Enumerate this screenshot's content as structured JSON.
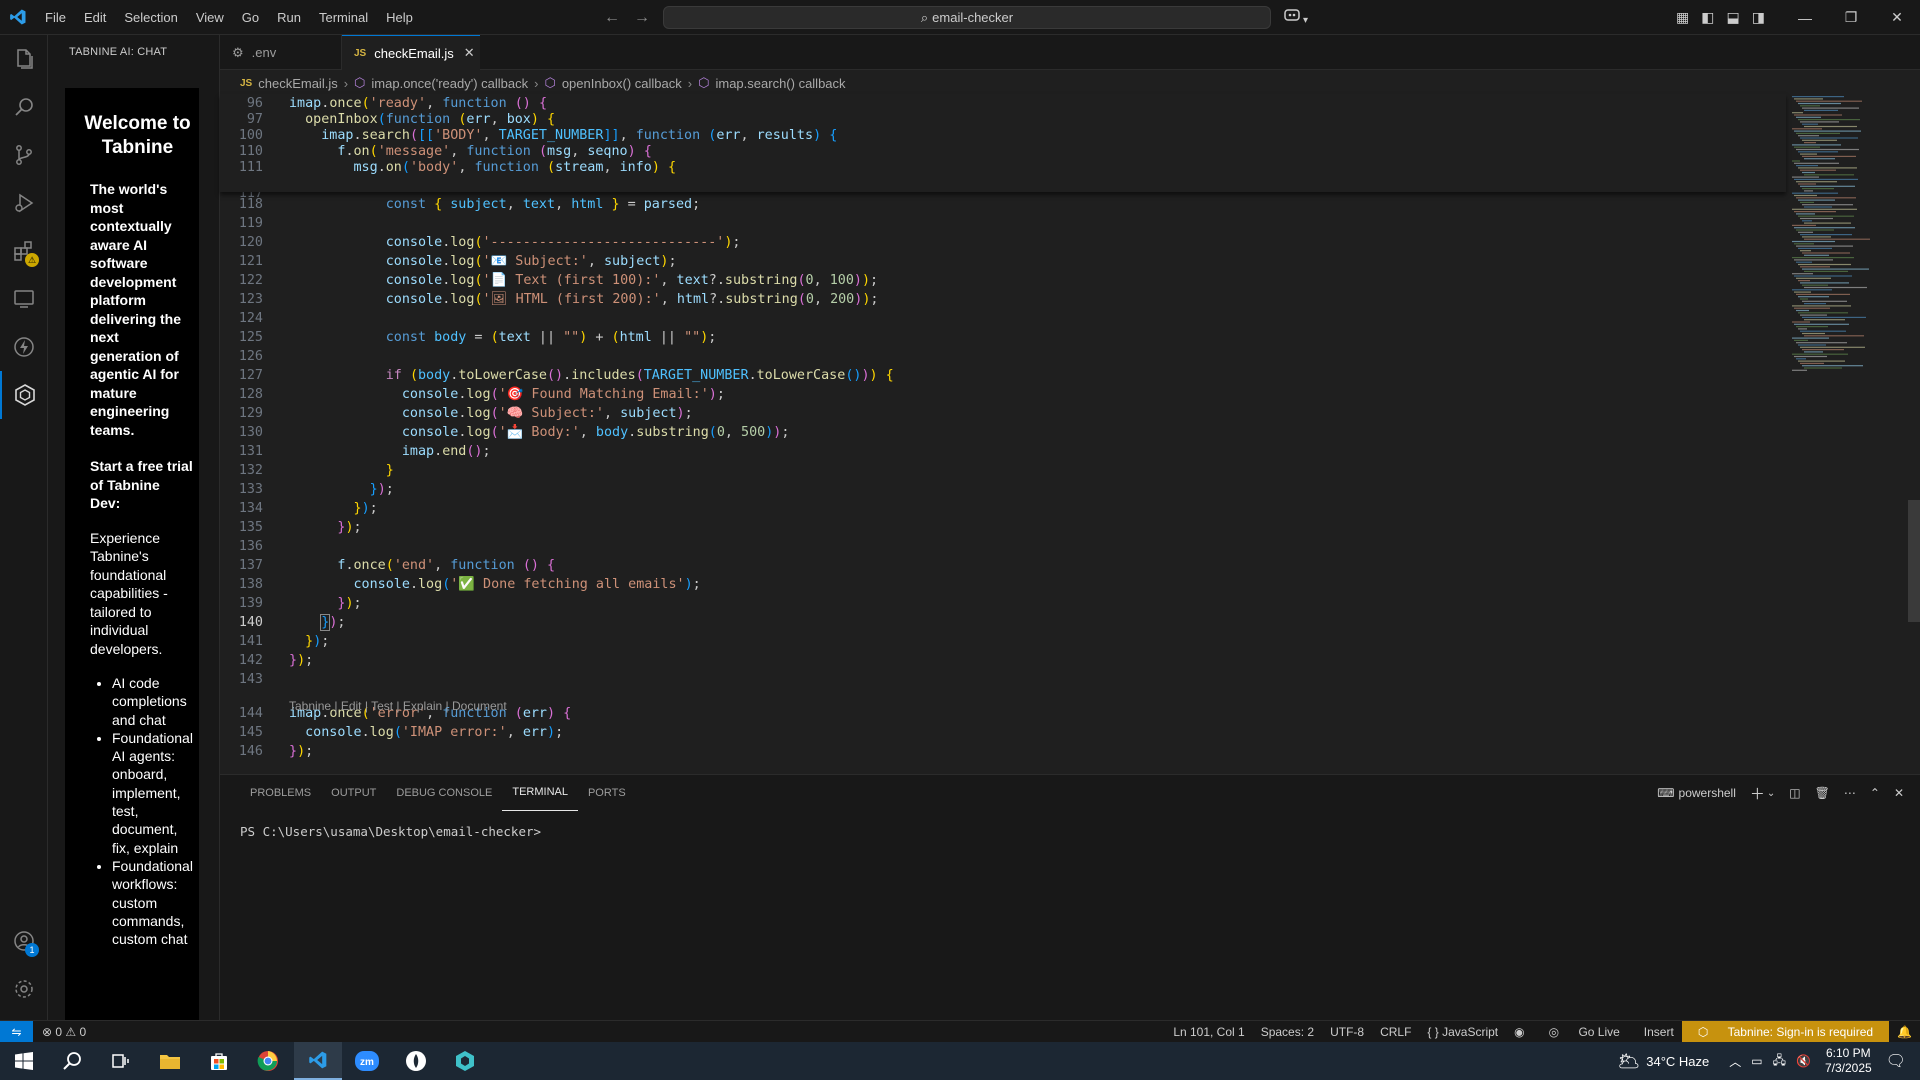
{
  "titlebar": {
    "menu": [
      "File",
      "Edit",
      "Selection",
      "View",
      "Go",
      "Run",
      "Terminal",
      "Help"
    ],
    "search": "email-checker"
  },
  "sidebar": {
    "title": "TABNINE AI: CHAT",
    "welcome": "Welcome to Tabnine",
    "intro": "The world's most contextually aware AI software development platform delivering the next generation of agentic AI for mature engineering teams.",
    "trial": "Start a free trial of Tabnine Dev:",
    "experience": "Experience Tabnine's foundational capabilities - tailored to individual developers.",
    "features": [
      "AI code completions and chat",
      "Foundational AI agents: onboard, implement, test, document, fix, explain",
      "Foundational workflows: custom commands, custom chat"
    ]
  },
  "activity_badges": {
    "extensions": "⚠",
    "accounts": "1"
  },
  "tabs": [
    {
      "label": ".env",
      "active": false
    },
    {
      "label": "checkEmail.js",
      "active": true
    }
  ],
  "breadcrumbs": [
    "checkEmail.js",
    "imap.once('ready') callback",
    "openInbox() callback",
    "imap.search() callback"
  ],
  "codelens": "Tabnine | Edit | Test | Explain | Document",
  "code": {
    "sticky": [
      {
        "n": "96",
        "html": "<span class='var'>imap</span>.<span class='fn'>once</span><span class='br1'>(</span><span class='str'>'ready'</span>, <span class='kw'>function</span> <span class='br2'>()</span> <span class='br2'>{</span>"
      },
      {
        "n": "97",
        "html": "  <span class='fn'>openInbox</span><span class='br3'>(</span><span class='kw'>function</span> <span class='br1'>(</span><span class='var'>err</span>, <span class='var'>box</span><span class='br1'>)</span> <span class='br1'>{</span>"
      },
      {
        "n": "100",
        "html": "    <span class='var'>imap</span>.<span class='fn'>search</span><span class='br2'>(</span><span class='br3'>[[</span><span class='str'>'BODY'</span>, <span class='ct'>TARGET_NUMBER</span><span class='br3'>]]</span>, <span class='kw'>function</span> <span class='br3'>(</span><span class='var'>err</span>, <span class='var'>results</span><span class='br3'>)</span> <span class='br3'>{</span>"
      },
      {
        "n": "110",
        "html": "      <span class='var'>f</span>.<span class='fn'>on</span><span class='br1'>(</span><span class='str'>'message'</span>, <span class='kw'>function</span> <span class='br2'>(</span><span class='var'>msg</span>, <span class='var'>seqno</span><span class='br2'>)</span> <span class='br2'>{</span>"
      },
      {
        "n": "111",
        "html": "        <span class='var'>msg</span>.<span class='fn'>on</span><span class='br3'>(</span><span class='str'>'body'</span>, <span class='kw'>function</span> <span class='br1'>(</span><span class='var'>stream</span>, <span class='var'>info</span><span class='br1'>)</span> <span class='br1'>{</span>"
      }
    ],
    "lines": [
      {
        "n": "117",
        "html": ""
      },
      {
        "n": "118",
        "html": "            <span class='kw'>const</span> <span class='br1'>{</span> <span class='ct'>subject</span>, <span class='ct'>text</span>, <span class='ct'>html</span> <span class='br1'>}</span> = <span class='var'>parsed</span>;"
      },
      {
        "n": "119",
        "html": ""
      },
      {
        "n": "120",
        "html": "            <span class='var'>console</span>.<span class='fn'>log</span><span class='br1'>(</span><span class='str'>'----------------------------'</span><span class='br1'>)</span>;"
      },
      {
        "n": "121",
        "html": "            <span class='var'>console</span>.<span class='fn'>log</span><span class='br1'>(</span><span class='str'>'📧 Subject:'</span>, <span class='var'>subject</span><span class='br1'>)</span>;"
      },
      {
        "n": "122",
        "html": "            <span class='var'>console</span>.<span class='fn'>log</span><span class='br1'>(</span><span class='str'>'📄 Text (first 100):'</span>, <span class='var'>text</span>?.<span class='fn'>substring</span><span class='br2'>(</span><span class='num'>0</span>, <span class='num'>100</span><span class='br2'>)</span><span class='br1'>)</span>;"
      },
      {
        "n": "123",
        "html": "            <span class='var'>console</span>.<span class='fn'>log</span><span class='br1'>(</span><span class='str'>'🖼 HTML (first 200):'</span>, <span class='var'>html</span>?.<span class='fn'>substring</span><span class='br2'>(</span><span class='num'>0</span>, <span class='num'>200</span><span class='br2'>)</span><span class='br1'>)</span>;"
      },
      {
        "n": "124",
        "html": ""
      },
      {
        "n": "125",
        "html": "            <span class='kw'>const</span> <span class='ct'>body</span> = <span class='br1'>(</span><span class='var'>text</span> || <span class='str'>\"\"</span><span class='br1'>)</span> + <span class='br1'>(</span><span class='var'>html</span> || <span class='str'>\"\"</span><span class='br1'>)</span>;"
      },
      {
        "n": "126",
        "html": ""
      },
      {
        "n": "127",
        "html": "            <span class='ctl'>if</span> <span class='br1'>(</span><span class='ct'>body</span>.<span class='fn'>toLowerCase</span><span class='br2'>()</span>.<span class='fn'>includes</span><span class='br2'>(</span><span class='ct'>TARGET_NUMBER</span>.<span class='fn'>toLowerCase</span><span class='br3'>()</span><span class='br2'>)</span><span class='br1'>)</span> <span class='br1'>{</span>"
      },
      {
        "n": "128",
        "html": "              <span class='var'>console</span>.<span class='fn'>log</span><span class='br2'>(</span><span class='str'>'🎯 Found Matching Email:'</span><span class='br2'>)</span>;"
      },
      {
        "n": "129",
        "html": "              <span class='var'>console</span>.<span class='fn'>log</span><span class='br2'>(</span><span class='str'>'🧠 Subject:'</span>, <span class='var'>subject</span><span class='br2'>)</span>;"
      },
      {
        "n": "130",
        "html": "              <span class='var'>console</span>.<span class='fn'>log</span><span class='br2'>(</span><span class='str'>'📩 Body:'</span>, <span class='ct'>body</span>.<span class='fn'>substring</span><span class='br3'>(</span><span class='num'>0</span>, <span class='num'>500</span><span class='br3'>)</span><span class='br2'>)</span>;"
      },
      {
        "n": "131",
        "html": "              <span class='var'>imap</span>.<span class='fn'>end</span><span class='br2'>()</span>;"
      },
      {
        "n": "132",
        "html": "            <span class='br1'>}</span>"
      },
      {
        "n": "133",
        "html": "          <span class='br3'>}</span><span class='br2'>)</span>;"
      },
      {
        "n": "134",
        "html": "        <span class='br1'>}</span><span class='br3'>)</span>;"
      },
      {
        "n": "135",
        "html": "      <span class='br2'>}</span><span class='br1'>)</span>;"
      },
      {
        "n": "136",
        "html": ""
      },
      {
        "n": "137",
        "html": "      <span class='var'>f</span>.<span class='fn'>once</span><span class='br1'>(</span><span class='str'>'end'</span>, <span class='kw'>function</span> <span class='br2'>()</span> <span class='br2'>{</span>"
      },
      {
        "n": "138",
        "html": "        <span class='var'>console</span>.<span class='fn'>log</span><span class='br3'>(</span><span class='str'>'✅ Done fetching all emails'</span><span class='br3'>)</span>;"
      },
      {
        "n": "139",
        "html": "      <span class='br2'>}</span><span class='br1'>)</span>;"
      },
      {
        "n": "140",
        "html": "    <span class='br3' style='outline:1px solid #888'>}</span><span class='br2'>)</span>;"
      },
      {
        "n": "141",
        "html": "  <span class='br1'>}</span><span class='br3'>)</span>;"
      },
      {
        "n": "142",
        "html": "<span class='br2'>}</span><span class='br1'>)</span>;"
      },
      {
        "n": "143",
        "html": ""
      },
      {
        "n": "144",
        "html": "<span class='var'>imap</span>.<span class='fn'>once</span><span class='br1'>(</span><span class='str'>'error'</span>, <span class='kw'>function</span> <span class='br2'>(</span><span class='var'>err</span><span class='br2'>)</span> <span class='br2'>{</span>"
      },
      {
        "n": "145",
        "html": "  <span class='var'>console</span>.<span class='fn'>log</span><span class='br3'>(</span><span class='str'>'IMAP error:'</span>, <span class='var'>err</span><span class='br3'>)</span>;"
      },
      {
        "n": "146",
        "html": "<span class='br2'>}</span><span class='br1'>)</span>;"
      }
    ]
  },
  "panel": {
    "tabs": [
      "PROBLEMS",
      "OUTPUT",
      "DEBUG CONSOLE",
      "TERMINAL",
      "PORTS"
    ],
    "active_tab": "TERMINAL",
    "shell": "powershell",
    "prompt": "PS C:\\Users\\usama\\Desktop\\email-checker>"
  },
  "statusbar": {
    "problems": "⊗ 0 ⚠ 0",
    "position": "Ln 101, Col 1",
    "spaces": "Spaces: 2",
    "encoding": "UTF-8",
    "eol": "CRLF",
    "language": "{ } JavaScript",
    "golive": "Go Live",
    "mode": "Insert",
    "tabnine": "Tabnine: Sign-in is required"
  },
  "taskbar": {
    "weather": "34°C  Haze",
    "time": "6:10 PM",
    "date": "7/3/2025"
  },
  "colors": {
    "accent": "#0078d4",
    "tabnine_status": "#c7920e"
  }
}
